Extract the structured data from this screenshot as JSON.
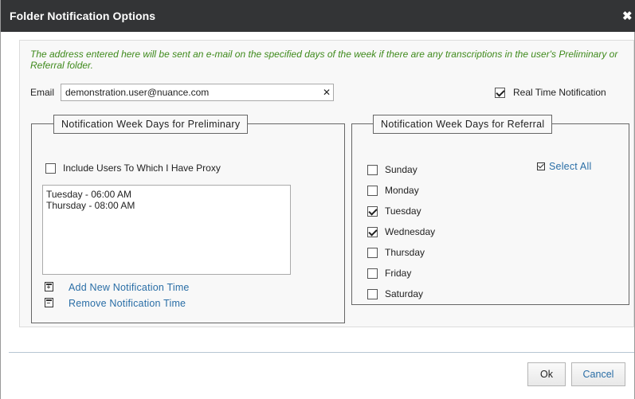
{
  "dialog": {
    "title": "Folder Notification Options",
    "close_glyph": "✖"
  },
  "info_text": "The address entered here will be sent an e-mail on the specified days of the week if there are any transcriptions in the user's Preliminary or Referral folder.",
  "email": {
    "label": "Email",
    "value": "demonstration.user@nuance.com",
    "clear_glyph": "✕"
  },
  "real_time": {
    "label": "Real Time Notification",
    "checked": true
  },
  "preliminary": {
    "legend": "Notification Week Days for Preliminary",
    "include_proxy": {
      "label": "Include Users To Which I Have Proxy",
      "checked": false
    },
    "times": [
      "Tuesday - 06:00 AM",
      "Thursday - 08:00 AM"
    ],
    "add_label": "Add New Notification Time",
    "remove_label": "Remove Notification Time"
  },
  "referral": {
    "legend": "Notification Week Days for Referral",
    "select_all": "Select All",
    "days": [
      {
        "label": "Sunday",
        "checked": false
      },
      {
        "label": "Monday",
        "checked": false
      },
      {
        "label": "Tuesday",
        "checked": true
      },
      {
        "label": "Wednesday",
        "checked": true
      },
      {
        "label": "Thursday",
        "checked": false
      },
      {
        "label": "Friday",
        "checked": false
      },
      {
        "label": "Saturday",
        "checked": false
      }
    ]
  },
  "buttons": {
    "ok": "Ok",
    "cancel": "Cancel"
  },
  "icons": {
    "close": "close-icon",
    "add": "calendar-add-icon",
    "remove": "calendar-remove-icon",
    "select_all": "checkbox-check-icon"
  },
  "colors": {
    "titlebar": "#333436",
    "info_text": "#3f8a1c",
    "link": "#2a6ea6"
  }
}
